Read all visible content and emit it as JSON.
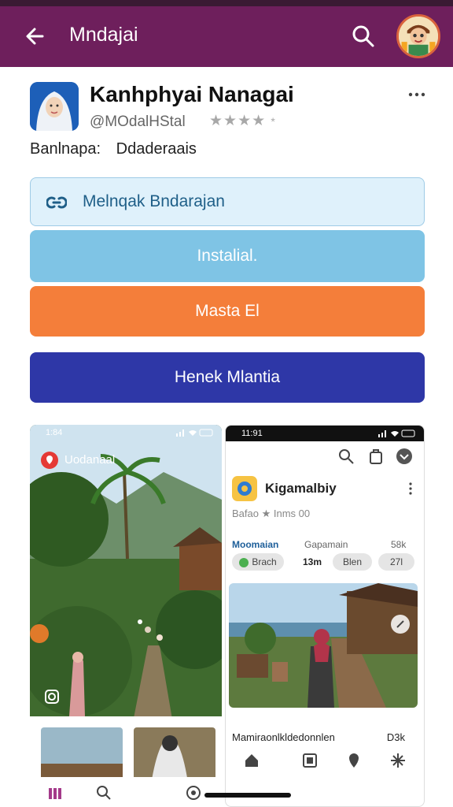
{
  "appbar": {
    "title": "Mndajai",
    "color": "#6e1f5c",
    "back_icon": "arrow-left-icon",
    "search_icon": "search-icon",
    "avatar_icon": "cartoon-avatar"
  },
  "app": {
    "name": "Kanhphyai Nanagai",
    "handle": "@MOdalHStal",
    "rating_stars": "★★★★",
    "rating_extra": "*",
    "meta_label": "Banlnapa:",
    "meta_value": "Ddaderaais",
    "more_icon": "more-horizontal-icon"
  },
  "buttons": {
    "link_label": "Melnqak Bndarajan",
    "link_icon": "link-icon",
    "install_label": "Instalial.",
    "orange_label": "Masta El",
    "indigo_label": "Henek Mlantia"
  },
  "colors": {
    "install": "#7fc4e5",
    "orange": "#f47e3a",
    "indigo": "#2e37a7"
  },
  "screenshot_left": {
    "time": "1:84",
    "badge_label": "Uodanaal"
  },
  "screenshot_right": {
    "time": "11:91",
    "app_name": "Kigamalbiy",
    "sub": "Bafao ★ Inms 00",
    "stats_row1": [
      "Moomaian",
      "Gapamain",
      "58k"
    ],
    "stats_row2": [
      "Brach",
      "13m",
      "Blen",
      "27l"
    ],
    "caption": "Mamiraonlkldedonnlen",
    "count": "D3k"
  }
}
